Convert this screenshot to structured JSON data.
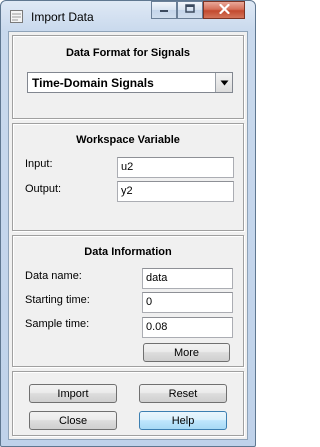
{
  "window": {
    "title": "Import Data"
  },
  "format_panel": {
    "title": "Data Format for Signals",
    "selected": "Time-Domain Signals"
  },
  "workspace_panel": {
    "title": "Workspace Variable",
    "input_label": "Input:",
    "input_value": "u2",
    "output_label": "Output:",
    "output_value": "y2"
  },
  "info_panel": {
    "title": "Data Information",
    "name_label": "Data name:",
    "name_value": "data",
    "start_label": "Starting time:",
    "start_value": "0",
    "sample_label": "Sample time:",
    "sample_value": "0.08",
    "more_label": "More"
  },
  "buttons": {
    "import": "Import",
    "reset": "Reset",
    "close": "Close",
    "help": "Help"
  },
  "icons": [
    "app-icon",
    "minimize-icon",
    "maximize-icon",
    "close-icon",
    "chevron-down-icon"
  ]
}
